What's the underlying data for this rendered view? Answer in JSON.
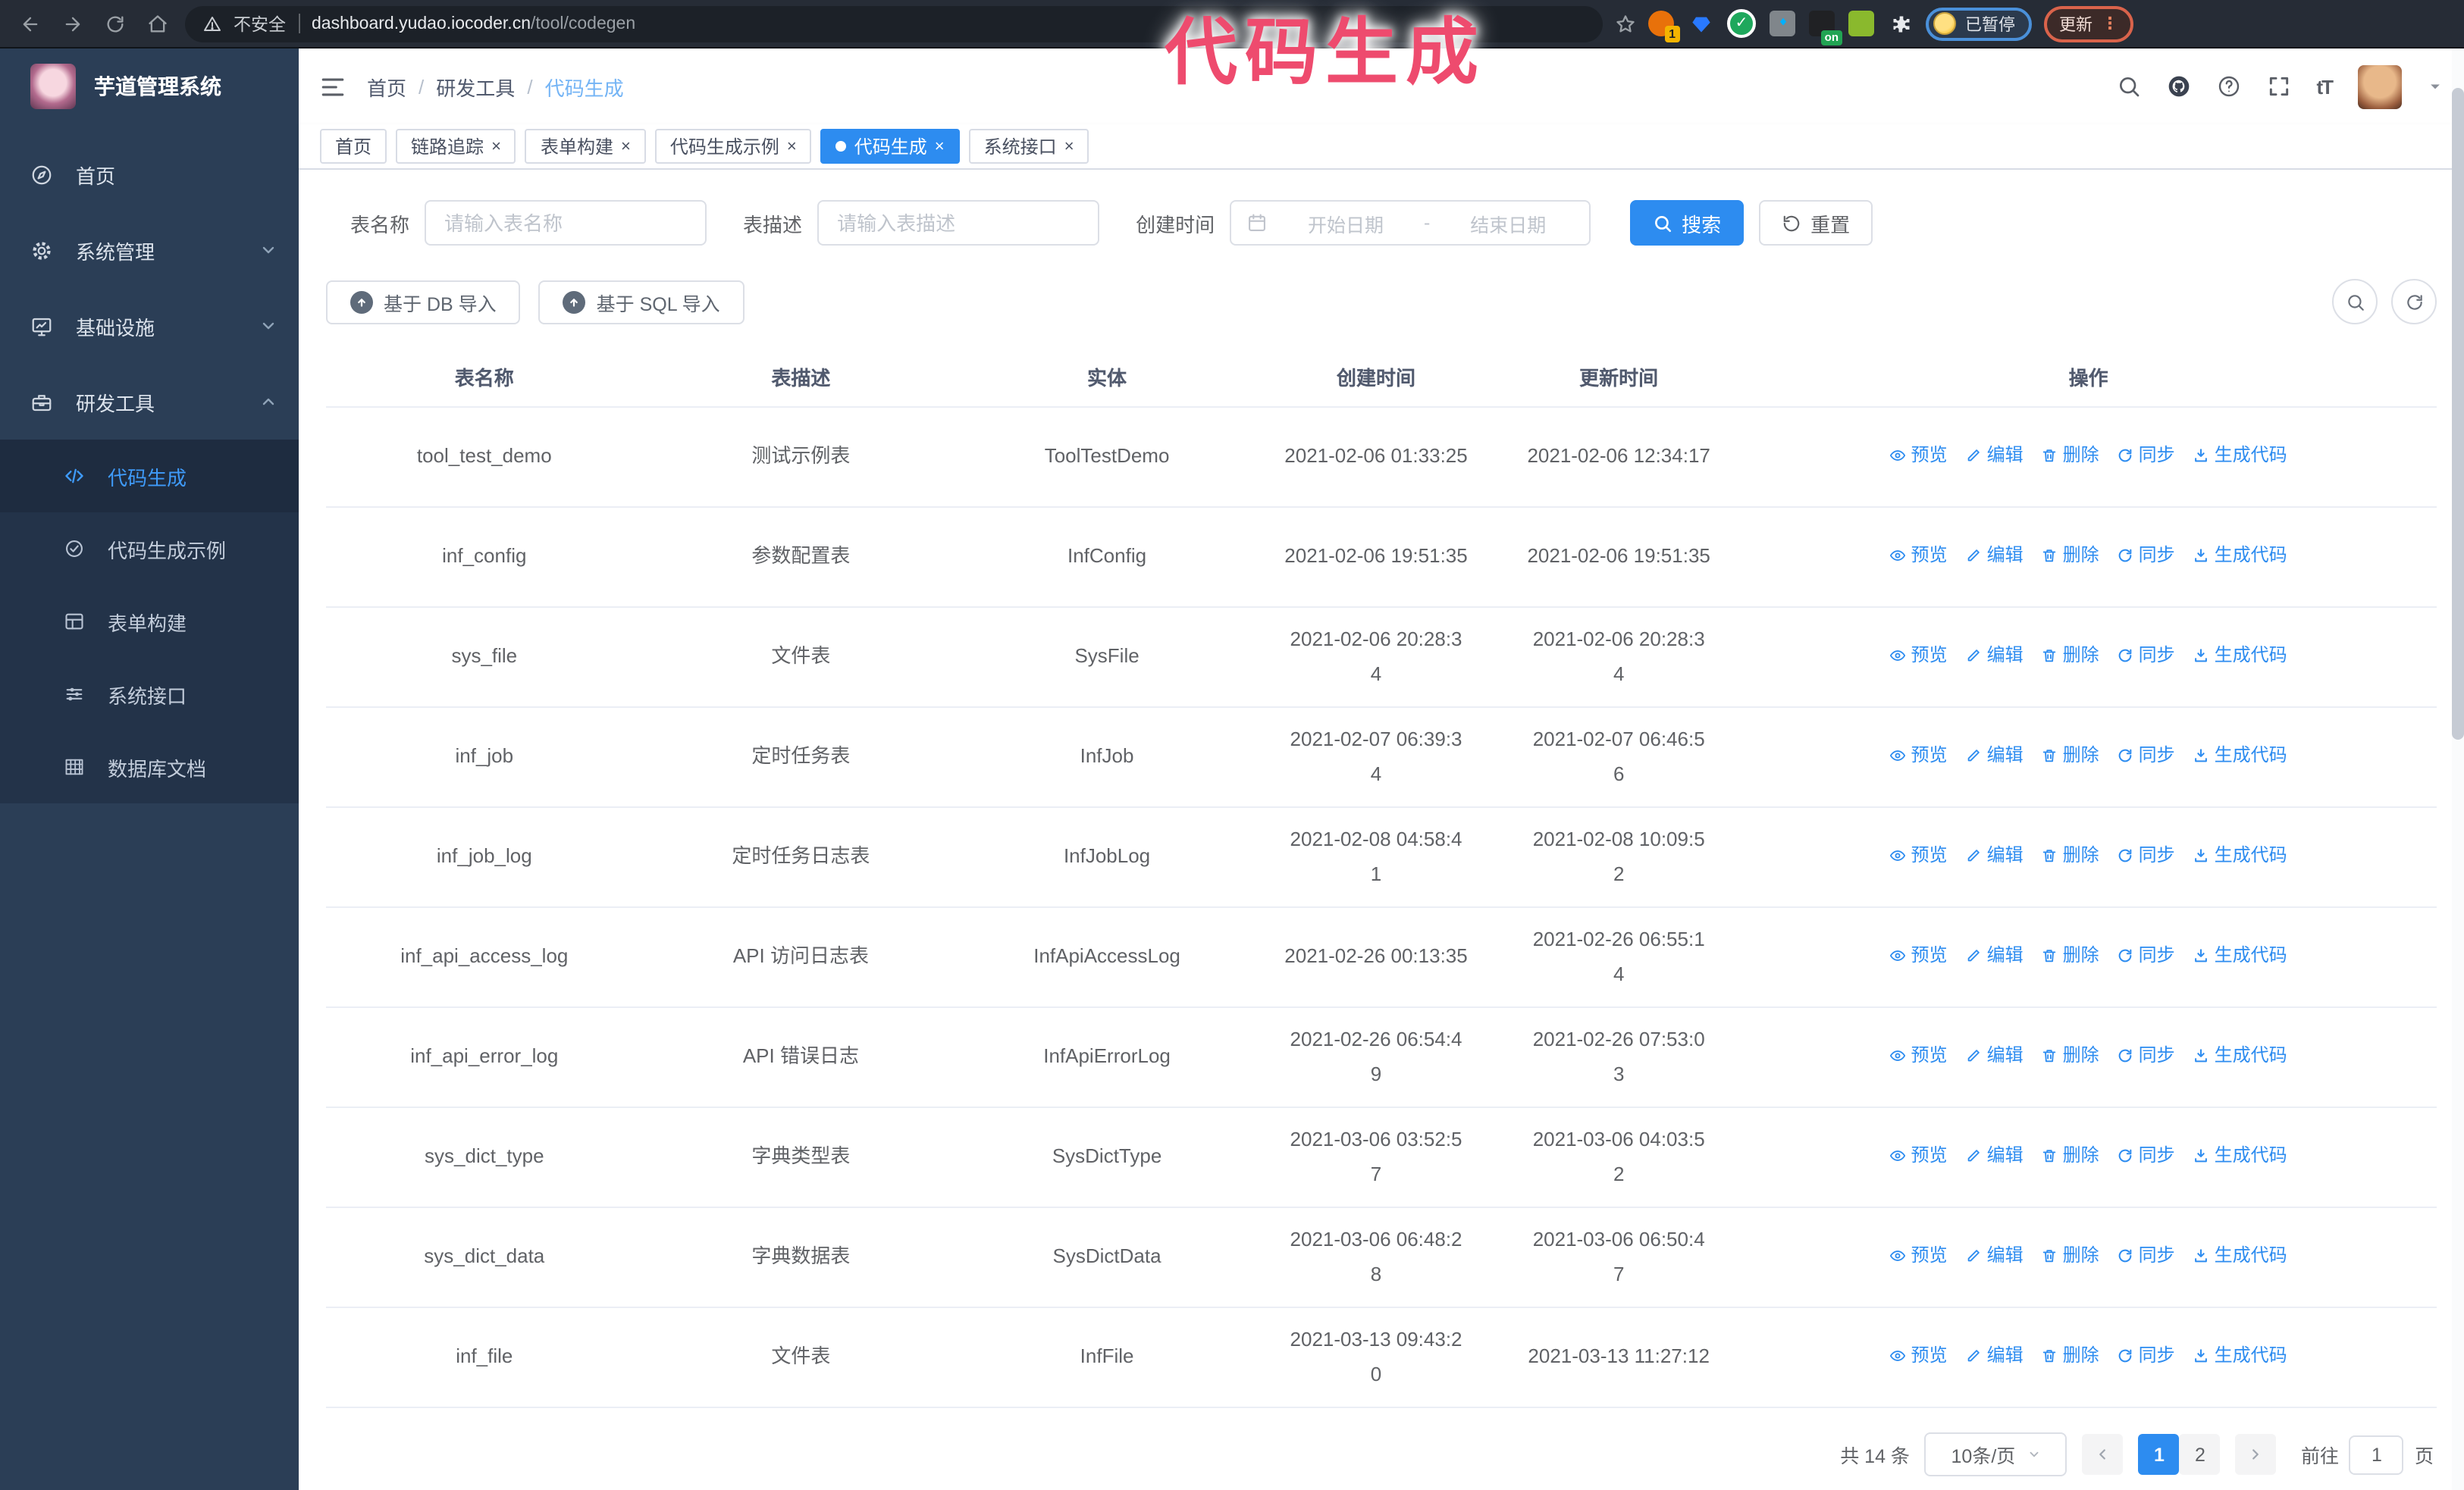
{
  "browser": {
    "security_warning": "不安全",
    "url_domain": "dashboard.yudao.iocoder.cn",
    "url_path": "/tool/codegen",
    "ext_badge_count": "1",
    "ext_badge_on": "on",
    "paused_badge": "已暂停",
    "update_button": "更新"
  },
  "annotation": "代码生成",
  "sidebar": {
    "title": "芋道管理系统",
    "items": [
      {
        "label": "首页",
        "icon": "home-icon",
        "expandable": false,
        "expanded": false
      },
      {
        "label": "系统管理",
        "icon": "gear-icon",
        "expandable": true,
        "expanded": false
      },
      {
        "label": "基础设施",
        "icon": "monitor-icon",
        "expandable": true,
        "expanded": false
      },
      {
        "label": "研发工具",
        "icon": "toolbox-icon",
        "expandable": true,
        "expanded": true
      }
    ],
    "subitems": [
      {
        "label": "代码生成",
        "icon": "code-icon",
        "active": true
      },
      {
        "label": "代码生成示例",
        "icon": "circle-check-icon",
        "active": false
      },
      {
        "label": "表单构建",
        "icon": "form-icon",
        "active": false
      },
      {
        "label": "系统接口",
        "icon": "sliders-icon",
        "active": false
      },
      {
        "label": "数据库文档",
        "icon": "grid-icon",
        "active": false
      }
    ]
  },
  "header": {
    "breadcrumb": [
      "首页",
      "研发工具",
      "代码生成"
    ]
  },
  "tabs": [
    {
      "label": "首页",
      "closable": false,
      "active": false
    },
    {
      "label": "链路追踪",
      "closable": true,
      "active": false
    },
    {
      "label": "表单构建",
      "closable": true,
      "active": false
    },
    {
      "label": "代码生成示例",
      "closable": true,
      "active": false
    },
    {
      "label": "代码生成",
      "closable": true,
      "active": true
    },
    {
      "label": "系统接口",
      "closable": true,
      "active": false
    }
  ],
  "search": {
    "name_label": "表名称",
    "name_placeholder": "请输入表名称",
    "desc_label": "表描述",
    "desc_placeholder": "请输入表描述",
    "time_label": "创建时间",
    "start_placeholder": "开始日期",
    "range_separator": "-",
    "end_placeholder": "结束日期",
    "search_button": "搜索",
    "reset_button": "重置"
  },
  "toolbar": {
    "import_db": "基于 DB 导入",
    "import_sql": "基于 SQL 导入"
  },
  "table": {
    "columns": [
      "表名称",
      "表描述",
      "实体",
      "创建时间",
      "更新时间",
      "操作"
    ],
    "actions": [
      "预览",
      "编辑",
      "删除",
      "同步",
      "生成代码"
    ],
    "rows": [
      {
        "name": "tool_test_demo",
        "desc": "测试示例表",
        "entity": "ToolTestDemo",
        "created": [
          "2021-02-06 01:33:25"
        ],
        "updated": [
          "2021-02-06 12:34:17"
        ]
      },
      {
        "name": "inf_config",
        "desc": "参数配置表",
        "entity": "InfConfig",
        "created": [
          "2021-02-06 19:51:35"
        ],
        "updated": [
          "2021-02-06 19:51:35"
        ]
      },
      {
        "name": "sys_file",
        "desc": "文件表",
        "entity": "SysFile",
        "created": [
          "2021-02-06 20:28:3",
          "4"
        ],
        "updated": [
          "2021-02-06 20:28:3",
          "4"
        ]
      },
      {
        "name": "inf_job",
        "desc": "定时任务表",
        "entity": "InfJob",
        "created": [
          "2021-02-07 06:39:3",
          "4"
        ],
        "updated": [
          "2021-02-07 06:46:5",
          "6"
        ]
      },
      {
        "name": "inf_job_log",
        "desc": "定时任务日志表",
        "entity": "InfJobLog",
        "created": [
          "2021-02-08 04:58:4",
          "1"
        ],
        "updated": [
          "2021-02-08 10:09:5",
          "2"
        ]
      },
      {
        "name": "inf_api_access_log",
        "desc": "API 访问日志表",
        "entity": "InfApiAccessLog",
        "created": [
          "2021-02-26 00:13:35"
        ],
        "updated": [
          "2021-02-26 06:55:1",
          "4"
        ]
      },
      {
        "name": "inf_api_error_log",
        "desc": "API 错误日志",
        "entity": "InfApiErrorLog",
        "created": [
          "2021-02-26 06:54:4",
          "9"
        ],
        "updated": [
          "2021-02-26 07:53:0",
          "3"
        ]
      },
      {
        "name": "sys_dict_type",
        "desc": "字典类型表",
        "entity": "SysDictType",
        "created": [
          "2021-03-06 03:52:5",
          "7"
        ],
        "updated": [
          "2021-03-06 04:03:5",
          "2"
        ]
      },
      {
        "name": "sys_dict_data",
        "desc": "字典数据表",
        "entity": "SysDictData",
        "created": [
          "2021-03-06 06:48:2",
          "8"
        ],
        "updated": [
          "2021-03-06 06:50:4",
          "7"
        ]
      },
      {
        "name": "inf_file",
        "desc": "文件表",
        "entity": "InfFile",
        "created": [
          "2021-03-13 09:43:2",
          "0"
        ],
        "updated": [
          "2021-03-13 11:27:12"
        ]
      }
    ]
  },
  "pagination": {
    "total": "共 14 条",
    "page_size": "10条/页",
    "pages": [
      "1",
      "2"
    ],
    "active_page": "1",
    "goto_label": "前往",
    "goto_value": "1",
    "page_label": "页"
  },
  "colors": {
    "accent": "#2d8cf0",
    "annotation": "#ee4b6e",
    "sidebar_bg": "#2b3e56",
    "submenu_bg": "#233349",
    "browser_bar_bg": "#262c36"
  }
}
